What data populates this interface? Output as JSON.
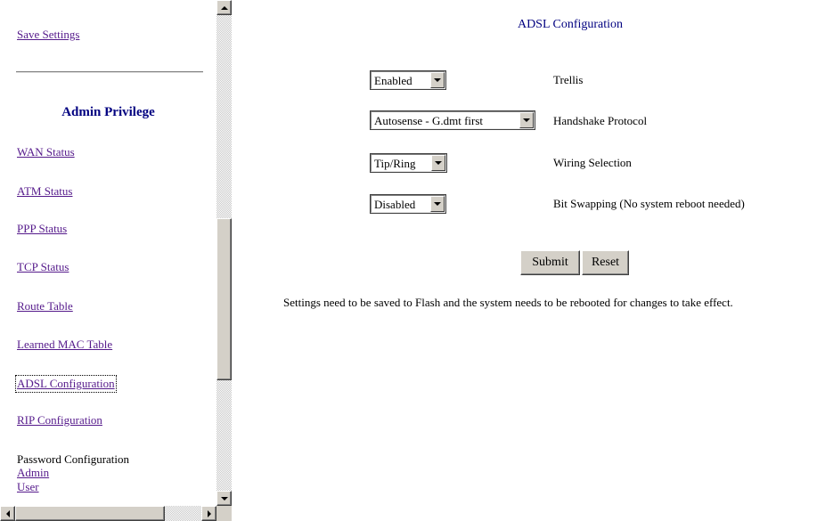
{
  "sidebar": {
    "save_settings": "Save Settings",
    "admin_heading": "Admin Privilege",
    "links": {
      "wan_status": "WAN Status",
      "atm_status": "ATM Status",
      "ppp_status": "PPP Status",
      "tcp_status": "TCP Status",
      "route_table": "Route Table",
      "learned_mac_table": "Learned MAC Table",
      "adsl_configuration": "ADSL Configuration",
      "rip_configuration": "RIP Configuration"
    },
    "password_configuration": "Password Configuration",
    "password_links": {
      "admin": "Admin",
      "user": "User"
    }
  },
  "main": {
    "title": "ADSL Configuration",
    "rows": {
      "trellis": {
        "value": "Enabled",
        "label": "Trellis"
      },
      "handshake": {
        "value": "Autosense - G.dmt first",
        "label": "Handshake Protocol"
      },
      "wiring": {
        "value": "Tip/Ring",
        "label": "Wiring Selection"
      },
      "bit_swapping": {
        "value": "Disabled",
        "label": "Bit Swapping (No system reboot needed)"
      }
    },
    "buttons": {
      "submit": "Submit",
      "reset": "Reset"
    },
    "note": "Settings need to be saved to Flash and the system needs to be rebooted for changes to take effect."
  },
  "icons": {
    "scroll_up": "scroll-up-arrow-icon",
    "scroll_down": "scroll-down-arrow-icon",
    "scroll_left": "scroll-left-arrow-icon",
    "scroll_right": "scroll-right-arrow-icon",
    "dropdown": "chevron-down-icon"
  },
  "colors": {
    "link": "#551a8b",
    "heading": "#000080",
    "button_face": "#d4d0c8"
  }
}
